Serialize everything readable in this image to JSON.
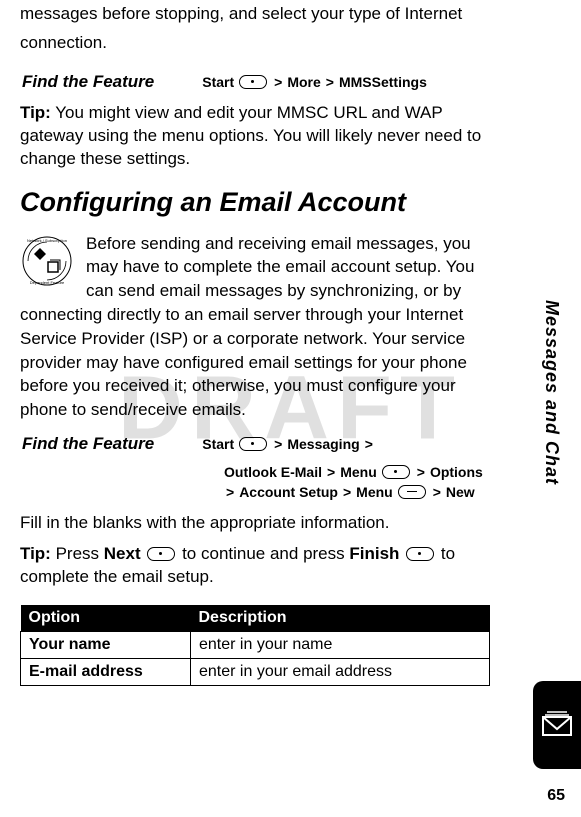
{
  "watermark": "DRAFT",
  "intro": "messages before stopping, and select your type of Internet connection.",
  "findFeatureLabel": "Find the Feature",
  "nav1": {
    "start": "Start",
    "more": "More",
    "mms": "MMSSettings"
  },
  "tip1": {
    "label": "Tip:",
    "text": " You might view and edit your MMSC URL and WAP gateway using the menu options. You will likely never need to change these settings."
  },
  "heading": "Configuring an Email Account",
  "body1": "Before sending and receiving email messages, you may have to complete the email account setup. You can send email messages by synchronizing, or by connecting directly to an email server through your Internet Service Provider (ISP) or a corporate network. Your service provider may have configured email settings for your phone before you received it; otherwise, you must configure your phone to send/receive emails.",
  "nav2": {
    "start": "Start",
    "messaging": "Messaging",
    "outlook": "Outlook E-Mail",
    "menu1": "Menu",
    "options": "Options",
    "account": "Account Setup",
    "menu2": "Menu",
    "new": "New"
  },
  "fill": "Fill in the blanks with the appropriate information.",
  "tip2": {
    "label": "Tip:",
    "pre": " Press ",
    "next": "Next",
    "mid": " to continue and press ",
    "finish": "Finish",
    "post": " to complete the email setup."
  },
  "table": {
    "headers": {
      "option": "Option",
      "description": "Description"
    },
    "rows": [
      {
        "option": "Your name",
        "description": "enter in your name"
      },
      {
        "option": "E-mail address",
        "description": "enter in your email address"
      }
    ]
  },
  "sidebar": "Messages and Chat",
  "pageNumber": "65",
  "sep": ">"
}
